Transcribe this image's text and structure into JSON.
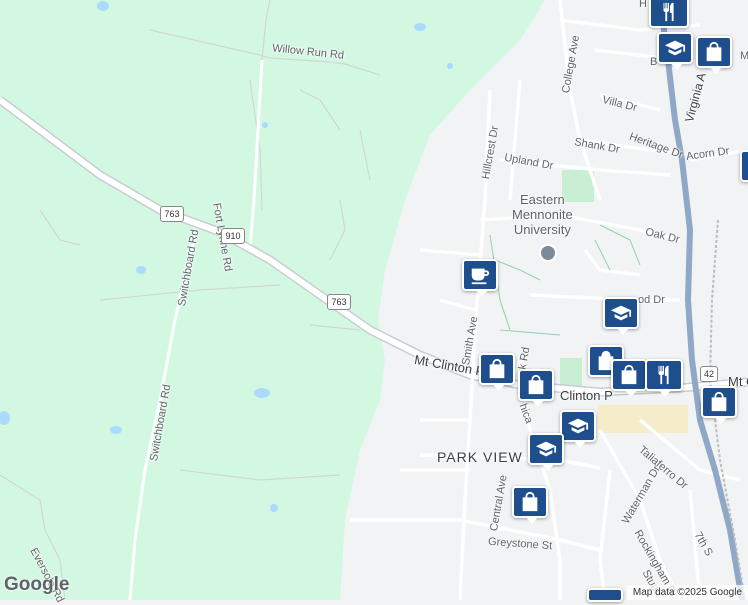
{
  "map": {
    "colors": {
      "land": "#f1f3f4",
      "park": "#d3f8e2",
      "water": "#aadaff",
      "road": "#ffffff",
      "highway": "#8fa8c8",
      "pin": "#1e4e8c"
    },
    "labels": {
      "willow_run": "Willow Run Rd",
      "fort_lynne": "Fort Lynne Rd",
      "switchboard1": "Switchboard Rd",
      "switchboard2": "Switchboard Rd",
      "eversole": "Eversole Rd",
      "mt_clinton": "Mt Clinton P",
      "mt_clinton_pike2": "Clinton P",
      "mt_c_right": "Mt C",
      "park_view": "PARK VIEW",
      "university": "Eastern\nMennonite\nUniversity",
      "college_ave": "College Ave",
      "hillcrest": "Hillcrest Dr",
      "upland": "Upland Dr",
      "shank": "Shank Dr",
      "heritage": "Heritage Dr",
      "acorn": "Acorn Dr",
      "villa": "Villa Dr",
      "oak": "Oak Dr",
      "wood": "od Dr",
      "smith": "Smith Ave",
      "park_rd": "rk Rd",
      "chica": "hica",
      "central": "Central Ave",
      "greystone": "Greystone St",
      "waterman": "Waterman Dr",
      "taliaferro": "Taliaferro Dr",
      "rockingham": "Rockingham Dr",
      "seventh": "7th S",
      "stuart": "Stuart",
      "virginia": "Virginia A",
      "b": "B",
      "h": "H",
      "ma": "Ma"
    },
    "shields": [
      "763",
      "910",
      "763",
      "42"
    ],
    "pins": [
      {
        "icon": "restaurant-icon"
      },
      {
        "icon": "education-icon"
      },
      {
        "icon": "shopping-bag-icon"
      },
      {
        "icon": "coffee-icon"
      },
      {
        "icon": "education-icon"
      },
      {
        "icon": "shopping-bag-icon"
      },
      {
        "icon": "shopping-bag-icon"
      },
      {
        "icon": "education-icon"
      },
      {
        "icon": "education-icon"
      },
      {
        "icon": "shopping-bag-icon"
      },
      {
        "icon": "restaurant-icon"
      },
      {
        "icon": "shopping-bag-icon"
      },
      {
        "icon": "shopping-bag-icon"
      },
      {
        "icon": "education-icon"
      }
    ],
    "attribution": "Map data ©2025 Google",
    "logo": "Google"
  }
}
